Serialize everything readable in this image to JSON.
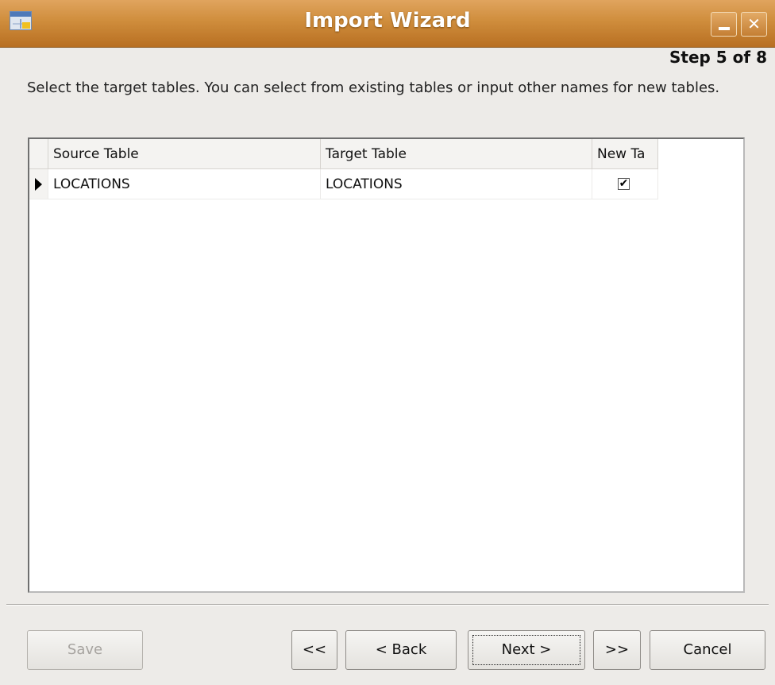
{
  "window": {
    "title": "Import Wizard",
    "minimize_icon": "minimize-icon",
    "close_icon": "close-icon"
  },
  "wizard": {
    "step": "Step 5 of 8",
    "instructions": "Select the target tables. You can select from existing tables or input other names for new tables."
  },
  "grid": {
    "columns": [
      "Source Table",
      "Target Table",
      "New Ta"
    ],
    "rows": [
      {
        "source": "LOCATIONS",
        "target": "LOCATIONS",
        "new_table": true
      }
    ]
  },
  "buttons": {
    "save": "Save",
    "first": "<<",
    "back": "< Back",
    "next": "Next >",
    "last": ">>",
    "cancel": "Cancel"
  },
  "colors": {
    "titlebar": "#cf8d3c",
    "background": "#edebe8"
  }
}
